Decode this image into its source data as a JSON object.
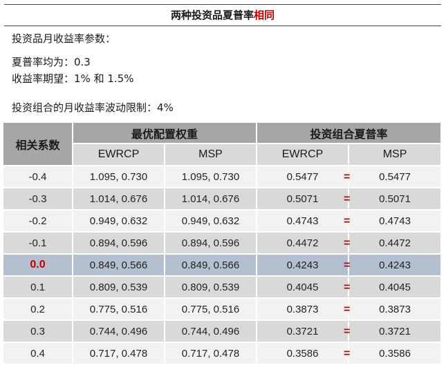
{
  "title": {
    "prefix": "两种投资品夏普率",
    "highlight": "相同"
  },
  "params": {
    "heading": "投资品月收益率参数：",
    "sharpe": "夏普率均为：0.3",
    "expected": "收益率期望：1% 和 1.5%",
    "vol_limit": "投资组合的月收益率波动限制：4%"
  },
  "table": {
    "corr_header": "相关系数",
    "group1": "最优配置权重",
    "group2": "投资组合夏普率",
    "sub_headers": [
      "EWRCP",
      "MSP",
      "EWRCP",
      "MSP"
    ],
    "eq_symbol": "=",
    "rows": [
      {
        "corr": "-0.4",
        "w_ewrcp": "1.095, 0.730",
        "w_msp": "1.095, 0.730",
        "s_ewrcp": "0.5477",
        "s_msp": "0.5477"
      },
      {
        "corr": "-0.3",
        "w_ewrcp": "1.014, 0.676",
        "w_msp": "1.014, 0.676",
        "s_ewrcp": "0.5071",
        "s_msp": "0.5071"
      },
      {
        "corr": "-0.2",
        "w_ewrcp": "0.949, 0.632",
        "w_msp": "0.949, 0.632",
        "s_ewrcp": "0.4743",
        "s_msp": "0.4743"
      },
      {
        "corr": "-0.1",
        "w_ewrcp": "0.894, 0.596",
        "w_msp": "0.894, 0.596",
        "s_ewrcp": "0.4472",
        "s_msp": "0.4472"
      },
      {
        "corr": "0.0",
        "w_ewrcp": "0.849, 0.566",
        "w_msp": "0.849, 0.566",
        "s_ewrcp": "0.4243",
        "s_msp": "0.4243"
      },
      {
        "corr": "0.1",
        "w_ewrcp": "0.809, 0.539",
        "w_msp": "0.809, 0.539",
        "s_ewrcp": "0.4045",
        "s_msp": "0.4045"
      },
      {
        "corr": "0.2",
        "w_ewrcp": "0.775, 0.516",
        "w_msp": "0.775, 0.516",
        "s_ewrcp": "0.3873",
        "s_msp": "0.3873"
      },
      {
        "corr": "0.3",
        "w_ewrcp": "0.744, 0.496",
        "w_msp": "0.744, 0.496",
        "s_ewrcp": "0.3721",
        "s_msp": "0.3721"
      },
      {
        "corr": "0.4",
        "w_ewrcp": "0.717, 0.478",
        "w_msp": "0.717, 0.478",
        "s_ewrcp": "0.3586",
        "s_msp": "0.3586"
      }
    ]
  },
  "colors": {
    "accent_red": "#c00000",
    "highlight_row": "#b4bfcf",
    "header_dark": "#a6a6a6",
    "header_light": "#d9d9d9"
  }
}
